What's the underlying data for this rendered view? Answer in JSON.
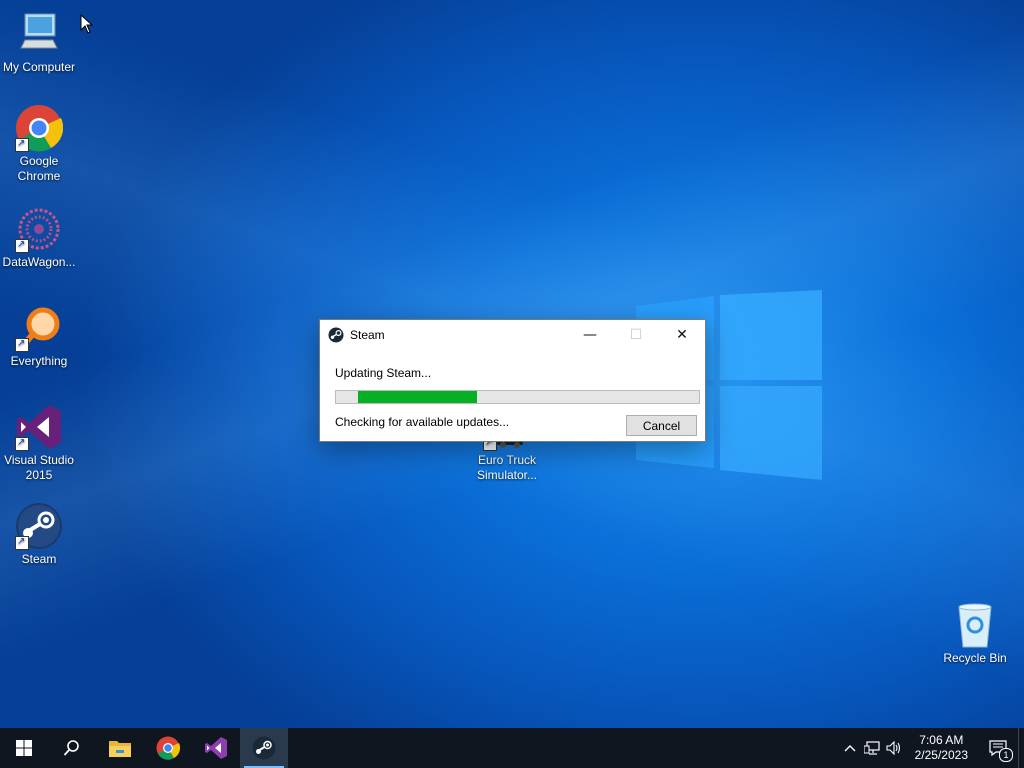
{
  "desktop": {
    "icons": [
      {
        "label": "My Computer"
      },
      {
        "label": "Google Chrome"
      },
      {
        "label": "DataWagon..."
      },
      {
        "label": "Everything"
      },
      {
        "label": "Visual Studio 2015"
      },
      {
        "label": "Steam"
      },
      {
        "label": "Euro Truck Simulator..."
      },
      {
        "label": "Recycle Bin"
      }
    ]
  },
  "dialog": {
    "title": "Steam",
    "status": "Updating Steam...",
    "detail": "Checking for available updates...",
    "progress_percent": 35,
    "cancel_label": "Cancel",
    "minimize_glyph": "—",
    "maximize_glyph": "☐",
    "close_glyph": "✕"
  },
  "taskbar": {
    "items": [
      "start-icon",
      "search-icon",
      "file-explorer-icon",
      "chrome-icon",
      "visual-studio-icon",
      "steam-icon"
    ],
    "active_item": "steam-icon",
    "clock_time": "7:06 AM",
    "clock_date": "2/25/2023",
    "notification_count": "1"
  },
  "colors": {
    "progress_fill": "#06b025",
    "taskbar_bg": "#0f1620"
  }
}
